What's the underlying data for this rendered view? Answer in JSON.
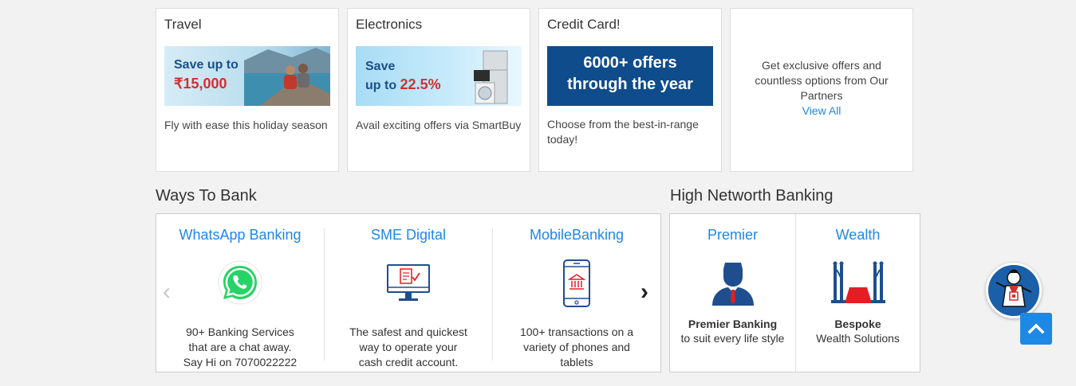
{
  "offers": [
    {
      "title": "Travel",
      "banner_line1": "Save up to",
      "banner_line2": "₹15,000",
      "desc": "Fly with ease this holiday season"
    },
    {
      "title": "Electronics",
      "banner_line1": "Save",
      "banner_line2_prefix": "up to ",
      "banner_line2_value": "22.5%",
      "desc": "Avail exciting offers via SmartBuy"
    },
    {
      "title": "Credit Card!",
      "banner_line1": "6000+ offers",
      "banner_line2": "through the year",
      "desc": "Choose from the best-in-range today!"
    }
  ],
  "partners": {
    "text": "Get exclusive offers and countless options from Our Partners",
    "link": "View All"
  },
  "ways_to_bank": {
    "heading": "Ways To Bank",
    "items": [
      {
        "title": "WhatsApp Banking",
        "icon": "whatsapp-icon",
        "desc_lines": [
          "90+ Banking Services",
          "that are a chat away.",
          "Say Hi on 7070022222"
        ]
      },
      {
        "title": "SME Digital",
        "icon": "monitor-document-icon",
        "desc_lines": [
          "The safest and quickest",
          "way to operate your",
          "cash credit account."
        ]
      },
      {
        "title": "MobileBanking",
        "icon": "mobile-bank-icon",
        "desc_lines": [
          "100+ transactions on a",
          "variety of phones and",
          "tablets"
        ]
      }
    ],
    "prev_glyph": "‹",
    "next_glyph": "›"
  },
  "hnw": {
    "heading": "High Networth Banking",
    "items": [
      {
        "title": "Premier",
        "icon": "premier-person-icon",
        "bold": "Premier Banking",
        "sub": "to suit every life style"
      },
      {
        "title": "Wealth",
        "icon": "red-carpet-icon",
        "bold": "Bespoke",
        "sub": "Wealth Solutions"
      }
    ]
  },
  "colors": {
    "link_blue": "#1e88e5",
    "brand_navy": "#004c8f",
    "accent_red": "#e31e24",
    "whatsapp_green": "#25d366"
  }
}
